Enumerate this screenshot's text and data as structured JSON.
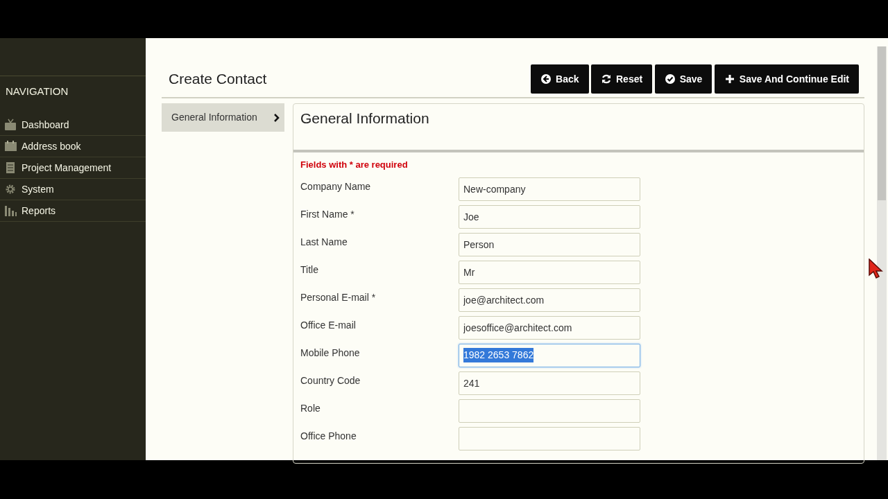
{
  "sidebar": {
    "title": "NAVIGATION",
    "items": [
      {
        "label": "Dashboard"
      },
      {
        "label": "Address book"
      },
      {
        "label": "Project Management"
      },
      {
        "label": "System"
      },
      {
        "label": "Reports"
      }
    ]
  },
  "page_title": "Create Contact",
  "buttons": [
    {
      "label": "Back"
    },
    {
      "label": "Reset"
    },
    {
      "label": "Save"
    },
    {
      "label": "Save And Continue Edit"
    }
  ],
  "sections": [
    {
      "label": "General Information",
      "selected": true
    }
  ],
  "form": {
    "title": "General Information",
    "note": "Fields with * are required",
    "fields": [
      {
        "label": "Company Name",
        "value": "New-company",
        "focused": false
      },
      {
        "label": "First Name *",
        "value": "Joe",
        "focused": false
      },
      {
        "label": "Last Name",
        "value": "Person",
        "focused": false
      },
      {
        "label": "Title",
        "value": "Mr",
        "focused": false
      },
      {
        "label": "Personal E-mail *",
        "value": "joe@architect.com",
        "focused": false
      },
      {
        "label": "Office E-mail",
        "value": "joesoffice@architect.com",
        "focused": false
      },
      {
        "label": "Mobile Phone",
        "value": "1982 2653 7862",
        "focused": true
      },
      {
        "label": "Country Code",
        "value": "241",
        "focused": false
      },
      {
        "label": "Role",
        "focused": false
      },
      {
        "label": "Office Phone",
        "focused": false
      }
    ]
  }
}
